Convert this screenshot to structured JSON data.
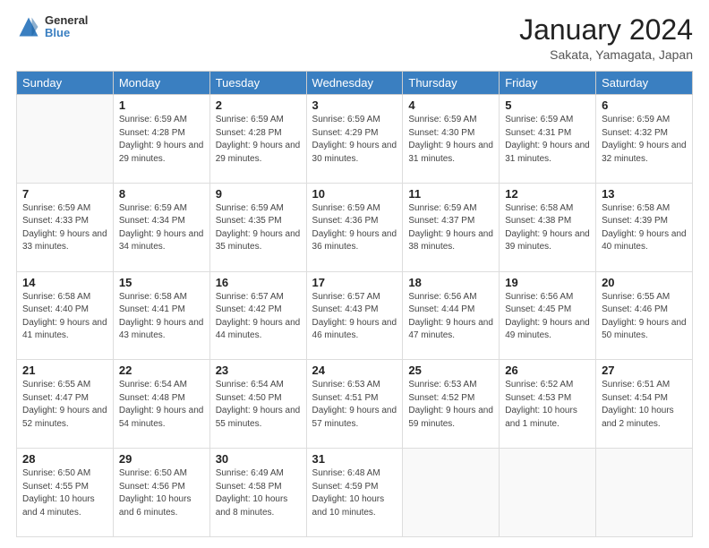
{
  "header": {
    "logo": {
      "general": "General",
      "blue": "Blue"
    },
    "title": "January 2024",
    "subtitle": "Sakata, Yamagata, Japan"
  },
  "calendar": {
    "days_of_week": [
      "Sunday",
      "Monday",
      "Tuesday",
      "Wednesday",
      "Thursday",
      "Friday",
      "Saturday"
    ],
    "weeks": [
      [
        {
          "day": null
        },
        {
          "day": "1",
          "sunrise": "Sunrise: 6:59 AM",
          "sunset": "Sunset: 4:28 PM",
          "daylight": "Daylight: 9 hours and 29 minutes."
        },
        {
          "day": "2",
          "sunrise": "Sunrise: 6:59 AM",
          "sunset": "Sunset: 4:28 PM",
          "daylight": "Daylight: 9 hours and 29 minutes."
        },
        {
          "day": "3",
          "sunrise": "Sunrise: 6:59 AM",
          "sunset": "Sunset: 4:29 PM",
          "daylight": "Daylight: 9 hours and 30 minutes."
        },
        {
          "day": "4",
          "sunrise": "Sunrise: 6:59 AM",
          "sunset": "Sunset: 4:30 PM",
          "daylight": "Daylight: 9 hours and 31 minutes."
        },
        {
          "day": "5",
          "sunrise": "Sunrise: 6:59 AM",
          "sunset": "Sunset: 4:31 PM",
          "daylight": "Daylight: 9 hours and 31 minutes."
        },
        {
          "day": "6",
          "sunrise": "Sunrise: 6:59 AM",
          "sunset": "Sunset: 4:32 PM",
          "daylight": "Daylight: 9 hours and 32 minutes."
        }
      ],
      [
        {
          "day": "7",
          "sunrise": "Sunrise: 6:59 AM",
          "sunset": "Sunset: 4:33 PM",
          "daylight": "Daylight: 9 hours and 33 minutes."
        },
        {
          "day": "8",
          "sunrise": "Sunrise: 6:59 AM",
          "sunset": "Sunset: 4:34 PM",
          "daylight": "Daylight: 9 hours and 34 minutes."
        },
        {
          "day": "9",
          "sunrise": "Sunrise: 6:59 AM",
          "sunset": "Sunset: 4:35 PM",
          "daylight": "Daylight: 9 hours and 35 minutes."
        },
        {
          "day": "10",
          "sunrise": "Sunrise: 6:59 AM",
          "sunset": "Sunset: 4:36 PM",
          "daylight": "Daylight: 9 hours and 36 minutes."
        },
        {
          "day": "11",
          "sunrise": "Sunrise: 6:59 AM",
          "sunset": "Sunset: 4:37 PM",
          "daylight": "Daylight: 9 hours and 38 minutes."
        },
        {
          "day": "12",
          "sunrise": "Sunrise: 6:58 AM",
          "sunset": "Sunset: 4:38 PM",
          "daylight": "Daylight: 9 hours and 39 minutes."
        },
        {
          "day": "13",
          "sunrise": "Sunrise: 6:58 AM",
          "sunset": "Sunset: 4:39 PM",
          "daylight": "Daylight: 9 hours and 40 minutes."
        }
      ],
      [
        {
          "day": "14",
          "sunrise": "Sunrise: 6:58 AM",
          "sunset": "Sunset: 4:40 PM",
          "daylight": "Daylight: 9 hours and 41 minutes."
        },
        {
          "day": "15",
          "sunrise": "Sunrise: 6:58 AM",
          "sunset": "Sunset: 4:41 PM",
          "daylight": "Daylight: 9 hours and 43 minutes."
        },
        {
          "day": "16",
          "sunrise": "Sunrise: 6:57 AM",
          "sunset": "Sunset: 4:42 PM",
          "daylight": "Daylight: 9 hours and 44 minutes."
        },
        {
          "day": "17",
          "sunrise": "Sunrise: 6:57 AM",
          "sunset": "Sunset: 4:43 PM",
          "daylight": "Daylight: 9 hours and 46 minutes."
        },
        {
          "day": "18",
          "sunrise": "Sunrise: 6:56 AM",
          "sunset": "Sunset: 4:44 PM",
          "daylight": "Daylight: 9 hours and 47 minutes."
        },
        {
          "day": "19",
          "sunrise": "Sunrise: 6:56 AM",
          "sunset": "Sunset: 4:45 PM",
          "daylight": "Daylight: 9 hours and 49 minutes."
        },
        {
          "day": "20",
          "sunrise": "Sunrise: 6:55 AM",
          "sunset": "Sunset: 4:46 PM",
          "daylight": "Daylight: 9 hours and 50 minutes."
        }
      ],
      [
        {
          "day": "21",
          "sunrise": "Sunrise: 6:55 AM",
          "sunset": "Sunset: 4:47 PM",
          "daylight": "Daylight: 9 hours and 52 minutes."
        },
        {
          "day": "22",
          "sunrise": "Sunrise: 6:54 AM",
          "sunset": "Sunset: 4:48 PM",
          "daylight": "Daylight: 9 hours and 54 minutes."
        },
        {
          "day": "23",
          "sunrise": "Sunrise: 6:54 AM",
          "sunset": "Sunset: 4:50 PM",
          "daylight": "Daylight: 9 hours and 55 minutes."
        },
        {
          "day": "24",
          "sunrise": "Sunrise: 6:53 AM",
          "sunset": "Sunset: 4:51 PM",
          "daylight": "Daylight: 9 hours and 57 minutes."
        },
        {
          "day": "25",
          "sunrise": "Sunrise: 6:53 AM",
          "sunset": "Sunset: 4:52 PM",
          "daylight": "Daylight: 9 hours and 59 minutes."
        },
        {
          "day": "26",
          "sunrise": "Sunrise: 6:52 AM",
          "sunset": "Sunset: 4:53 PM",
          "daylight": "Daylight: 10 hours and 1 minute."
        },
        {
          "day": "27",
          "sunrise": "Sunrise: 6:51 AM",
          "sunset": "Sunset: 4:54 PM",
          "daylight": "Daylight: 10 hours and 2 minutes."
        }
      ],
      [
        {
          "day": "28",
          "sunrise": "Sunrise: 6:50 AM",
          "sunset": "Sunset: 4:55 PM",
          "daylight": "Daylight: 10 hours and 4 minutes."
        },
        {
          "day": "29",
          "sunrise": "Sunrise: 6:50 AM",
          "sunset": "Sunset: 4:56 PM",
          "daylight": "Daylight: 10 hours and 6 minutes."
        },
        {
          "day": "30",
          "sunrise": "Sunrise: 6:49 AM",
          "sunset": "Sunset: 4:58 PM",
          "daylight": "Daylight: 10 hours and 8 minutes."
        },
        {
          "day": "31",
          "sunrise": "Sunrise: 6:48 AM",
          "sunset": "Sunset: 4:59 PM",
          "daylight": "Daylight: 10 hours and 10 minutes."
        },
        {
          "day": null
        },
        {
          "day": null
        },
        {
          "day": null
        }
      ]
    ]
  }
}
